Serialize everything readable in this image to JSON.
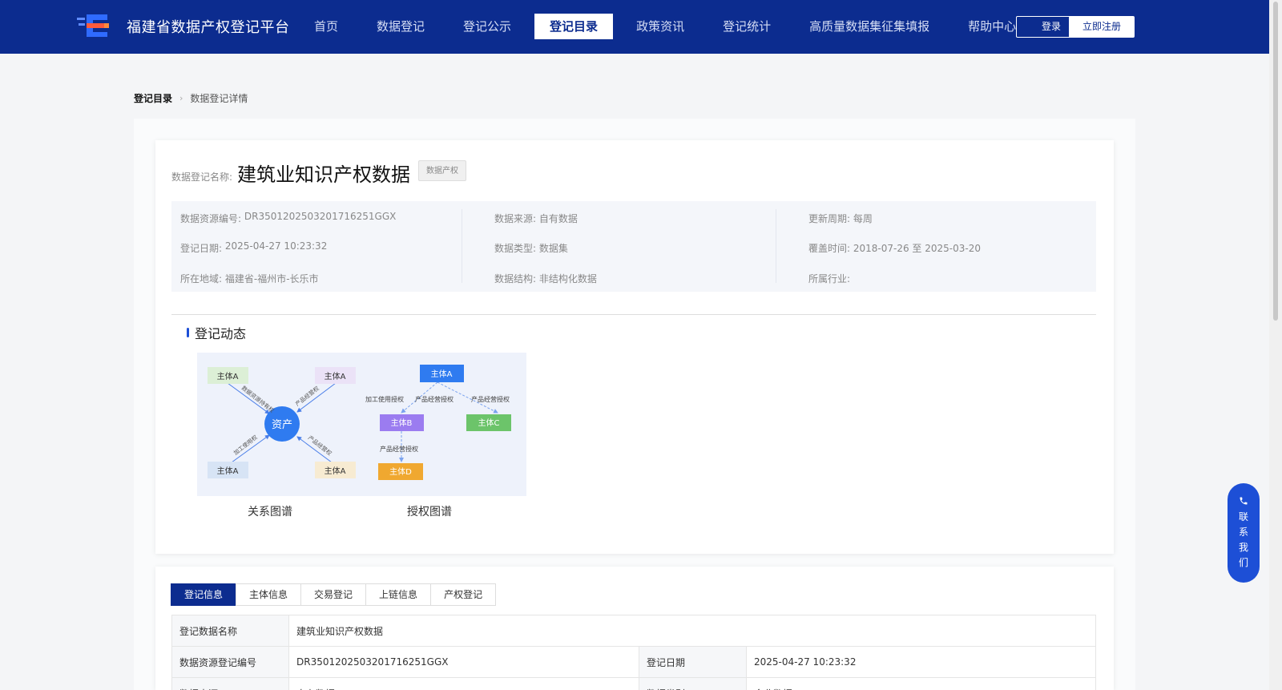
{
  "header": {
    "site_title": "福建省数据产权登记平台",
    "nav": [
      {
        "label": "首页",
        "active": false
      },
      {
        "label": "数据登记",
        "active": false
      },
      {
        "label": "登记公示",
        "active": false
      },
      {
        "label": "登记目录",
        "active": true
      },
      {
        "label": "政策资讯",
        "active": false
      },
      {
        "label": "登记统计",
        "active": false
      },
      {
        "label": "高质量数据集征集填报",
        "active": false
      },
      {
        "label": "帮助中心",
        "active": false
      }
    ],
    "login_label": "登录",
    "register_label": "立即注册",
    "brand_color": "#0c2c8f"
  },
  "breadcrumb": {
    "root": "登记目录",
    "current": "数据登记详情"
  },
  "detail": {
    "name_label": "数据登记名称:",
    "name_value": "建筑业知识产权数据",
    "tag": "数据产权",
    "info": {
      "resource_no_label": "数据资源编号:",
      "resource_no": "DR3501202503201716251GGX",
      "reg_date_label": "登记日期:",
      "reg_date": "2025-04-27 10:23:32",
      "region_label": "所在地域:",
      "region": "福建省-福州市-长乐市",
      "source_label": "数据来源:",
      "source": "自有数据",
      "type_label": "数据类型:",
      "type": "数据集",
      "structure_label": "数据结构:",
      "structure": "非结构化数据",
      "cycle_label": "更新周期:",
      "cycle": "每周",
      "coverage_label": "覆盖时间:",
      "coverage": "2018-07-26 至 2025-03-20",
      "industry_label": "所属行业:",
      "industry": ""
    }
  },
  "dynamics": {
    "title": "登记动态",
    "relation_caption": "关系图谱",
    "auth_caption": "授权图谱",
    "relation": {
      "center": "资产",
      "nodes": [
        "主体A",
        "主体A",
        "主体A",
        "主体A"
      ],
      "edges": [
        "数据资源持有权",
        "产品经营权",
        "加工使用权",
        "产品经营权"
      ]
    },
    "authorization": {
      "top": "主体A",
      "b": "主体B",
      "c": "主体C",
      "d": "主体D",
      "edge_ab1": "加工使用授权",
      "edge_ab2": "产品经营授权",
      "edge_ac": "产品经营授权",
      "edge_bd": "产品经营授权"
    }
  },
  "tabs": [
    {
      "label": "登记信息",
      "active": true
    },
    {
      "label": "主体信息",
      "active": false
    },
    {
      "label": "交易登记",
      "active": false
    },
    {
      "label": "上链信息",
      "active": false
    },
    {
      "label": "产权登记",
      "active": false
    }
  ],
  "table": {
    "r1_k": "登记数据名称",
    "r1_v": "建筑业知识产权数据",
    "r2_k1": "数据资源登记编号",
    "r2_v1": "DR3501202503201716251GGX",
    "r2_k2": "登记日期",
    "r2_v2": "2025-04-27 10:23:32",
    "r3_k1": "数据来源",
    "r3_v1": "自有数据",
    "r3_k2": "数据类别",
    "r3_v2": "企业数据"
  },
  "contact": {
    "icon": "phone-icon",
    "label_chars": [
      "联",
      "系",
      "我",
      "们"
    ]
  }
}
